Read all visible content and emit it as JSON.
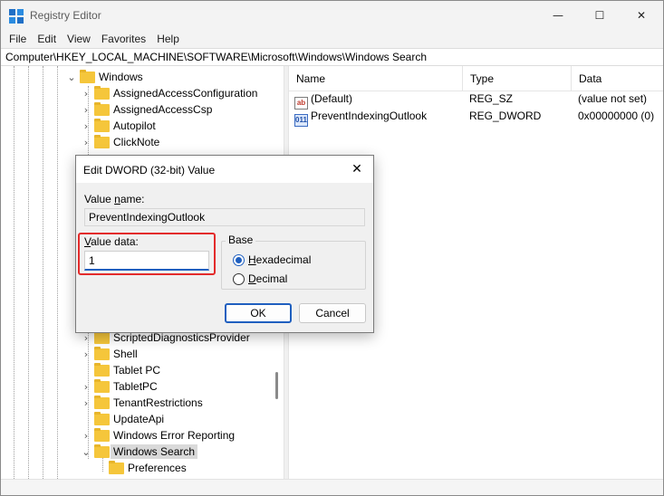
{
  "window": {
    "title": "Registry Editor",
    "controls": {
      "minimize": "—",
      "maximize": "☐",
      "close": "✕"
    }
  },
  "menu": [
    "File",
    "Edit",
    "View",
    "Favorites",
    "Help"
  ],
  "address": "Computer\\HKEY_LOCAL_MACHINE\\SOFTWARE\\Microsoft\\Windows\\Windows Search",
  "tree": {
    "items": [
      {
        "label": "Windows",
        "expander": "⌄",
        "indent": 0
      },
      {
        "label": "AssignedAccessConfiguration",
        "expander": "›",
        "indent": 1
      },
      {
        "label": "AssignedAccessCsp",
        "expander": "›",
        "indent": 1
      },
      {
        "label": "Autopilot",
        "expander": "›",
        "indent": 1
      },
      {
        "label": "ClickNote",
        "expander": "›",
        "indent": 1
      },
      {
        "label": "ScriptedDiagnosticsProvider",
        "expander": "›",
        "indent": 1
      },
      {
        "label": "Shell",
        "expander": "›",
        "indent": 1
      },
      {
        "label": "Tablet PC",
        "expander": "",
        "indent": 1
      },
      {
        "label": "TabletPC",
        "expander": "›",
        "indent": 1
      },
      {
        "label": "TenantRestrictions",
        "expander": "›",
        "indent": 1
      },
      {
        "label": "UpdateApi",
        "expander": "",
        "indent": 1
      },
      {
        "label": "Windows Error Reporting",
        "expander": "›",
        "indent": 1
      },
      {
        "label": "Windows Search",
        "expander": "⌄",
        "indent": 1,
        "selected": true
      },
      {
        "label": "Preferences",
        "expander": "",
        "indent": 2
      }
    ]
  },
  "list": {
    "columns": [
      "Name",
      "Type",
      "Data"
    ],
    "rows": [
      {
        "icon": "string-value-icon",
        "icon_text": "ab",
        "name": "(Default)",
        "type": "REG_SZ",
        "data": "(value not set)"
      },
      {
        "icon": "dword-value-icon",
        "icon_text": "011",
        "name": "PreventIndexingOutlook",
        "type": "REG_DWORD",
        "data": "0x00000000 (0)"
      }
    ]
  },
  "dialog": {
    "title": "Edit DWORD (32-bit) Value",
    "close": "✕",
    "value_name_label_pre": "Value ",
    "value_name_label_u": "n",
    "value_name_label_post": "ame:",
    "value_name": "PreventIndexingOutlook",
    "value_data_label_u": "V",
    "value_data_label_post": "alue data:",
    "value_data": "1",
    "base_label": "Base",
    "hex_u": "H",
    "hex_post": "exadecimal",
    "dec_u": "D",
    "dec_post": "ecimal",
    "selected_base": "Hexadecimal",
    "ok": "OK",
    "cancel": "Cancel",
    "highlight_color": "#e32b2b",
    "accent_color": "#1f5fbf"
  }
}
